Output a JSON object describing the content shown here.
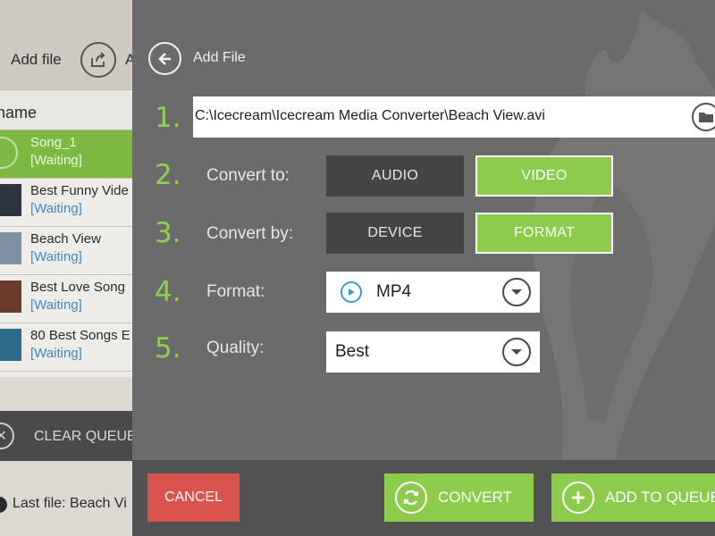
{
  "left_app": {
    "toolbar": {
      "add_file": "Add file",
      "share_partial": "A"
    },
    "list_header": "name",
    "files": [
      {
        "name": "Song_1",
        "status": "[Waiting]",
        "active": true
      },
      {
        "name": "Best Funny Vide",
        "status": "[Waiting]",
        "active": false
      },
      {
        "name": "Beach View",
        "status": "[Waiting]",
        "active": false
      },
      {
        "name": "Best Love Song",
        "status": "[Waiting]",
        "active": false
      },
      {
        "name": "80 Best Songs E",
        "status": "[Waiting]",
        "active": false
      }
    ],
    "clear_queue": "CLEAR QUEUE",
    "last_file": "Last file: Beach Vi"
  },
  "dialog": {
    "title": "Add File",
    "steps": [
      {
        "number": "1."
      },
      {
        "number": "2.",
        "label": "Convert to:"
      },
      {
        "number": "3.",
        "label": "Convert by:"
      },
      {
        "number": "4.",
        "label": "Format:"
      },
      {
        "number": "5.",
        "label": "Quality:"
      }
    ],
    "file_path": "C:\\Icecream\\Icecream Media Converter\\Beach View.avi",
    "convert_to": {
      "audio": "AUDIO",
      "video": "VIDEO",
      "selected": "VIDEO"
    },
    "convert_by": {
      "device": "DEVICE",
      "format": "FORMAT",
      "selected": "FORMAT"
    },
    "format_value": "MP4",
    "quality_value": "Best"
  },
  "bottom_bar": {
    "cancel": "CANCEL",
    "convert": "CONVERT",
    "add_to_queue": "ADD TO QUEUE"
  },
  "colors": {
    "accent_green": "#8dcb4d",
    "cancel_red": "#d9534f",
    "dialog_bg": "#6b6b6b",
    "toggle_off": "#454545",
    "status_blue": "#3a8bc4"
  },
  "icons": [
    "back-arrow-icon",
    "share-icon",
    "folder-icon",
    "chevron-down-icon",
    "play-icon",
    "refresh-icon",
    "plus-icon",
    "close-icon",
    "music-note-icon"
  ]
}
